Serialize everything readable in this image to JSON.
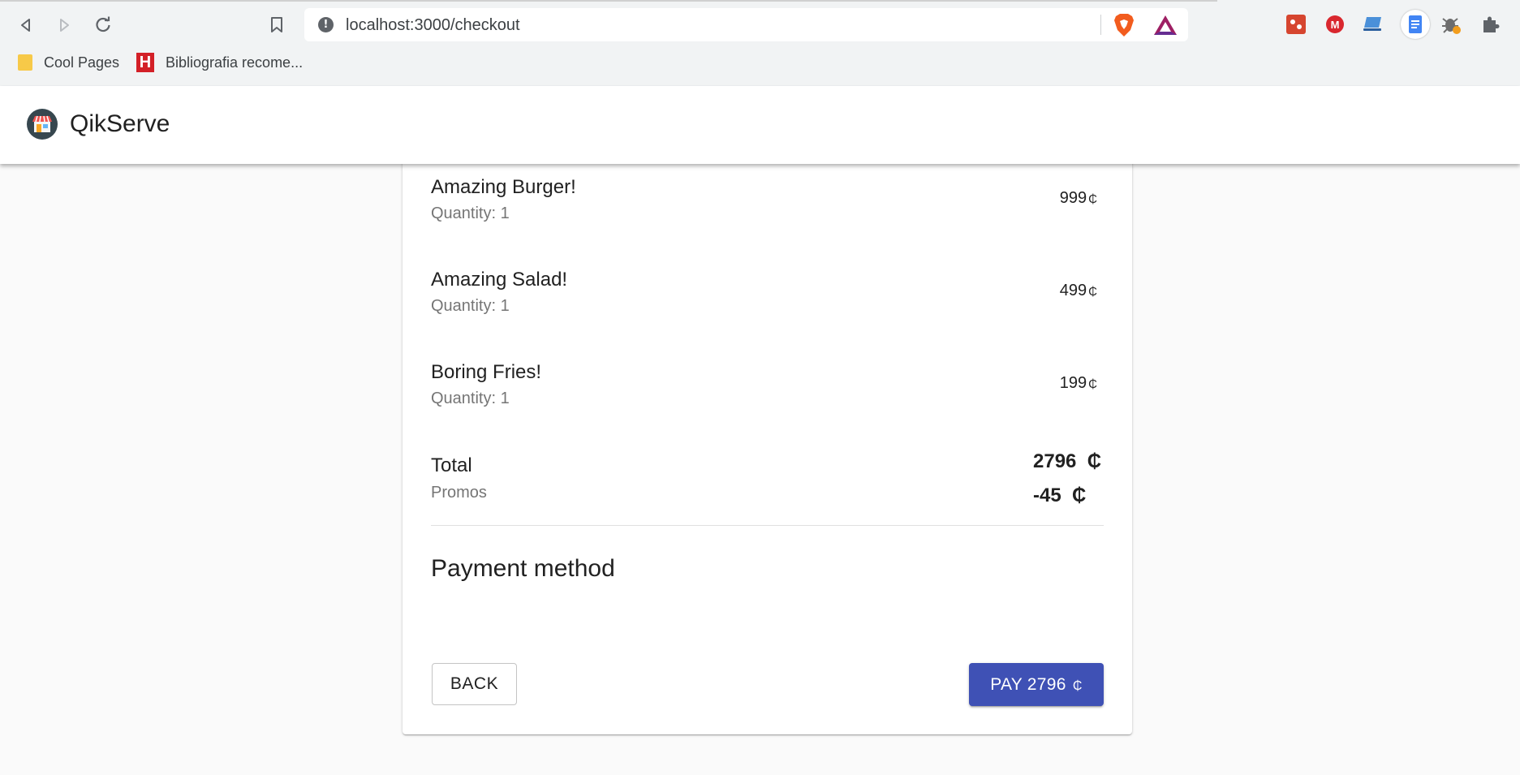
{
  "browser": {
    "url": "localhost:3000/checkout",
    "bookmarks": [
      {
        "label": "Cool Pages",
        "icon": "folder-icon"
      },
      {
        "label": "Bibliografia recome...",
        "icon": "h-icon"
      }
    ],
    "extensions": [
      "puzzle-game-icon",
      "mega-icon",
      "laptop-icon",
      "docs-icon",
      "bug-icon",
      "puzzle-icon"
    ]
  },
  "app": {
    "title": "QikServe",
    "logo_icon": "store-icon"
  },
  "order": {
    "items": [
      {
        "name": "Amazing Burger!",
        "quantity": "Quantity: 1",
        "price": "999",
        "currency": "₵"
      },
      {
        "name": "Amazing Salad!",
        "quantity": "Quantity: 1",
        "price": "499",
        "currency": "₵"
      },
      {
        "name": "Boring Fries!",
        "quantity": "Quantity: 1",
        "price": "199",
        "currency": "₵"
      }
    ],
    "total_label": "Total",
    "total_value": "2796",
    "promos_label": "Promos",
    "promos_value": "-45",
    "currency": "₵"
  },
  "payment": {
    "title": "Payment method",
    "back_label": "BACK",
    "pay_label": "PAY 2796",
    "pay_currency": "₵"
  },
  "colors": {
    "primary": "#3f51b5",
    "background": "#fafafa",
    "card": "#ffffff",
    "secondary_text": "#757575"
  }
}
